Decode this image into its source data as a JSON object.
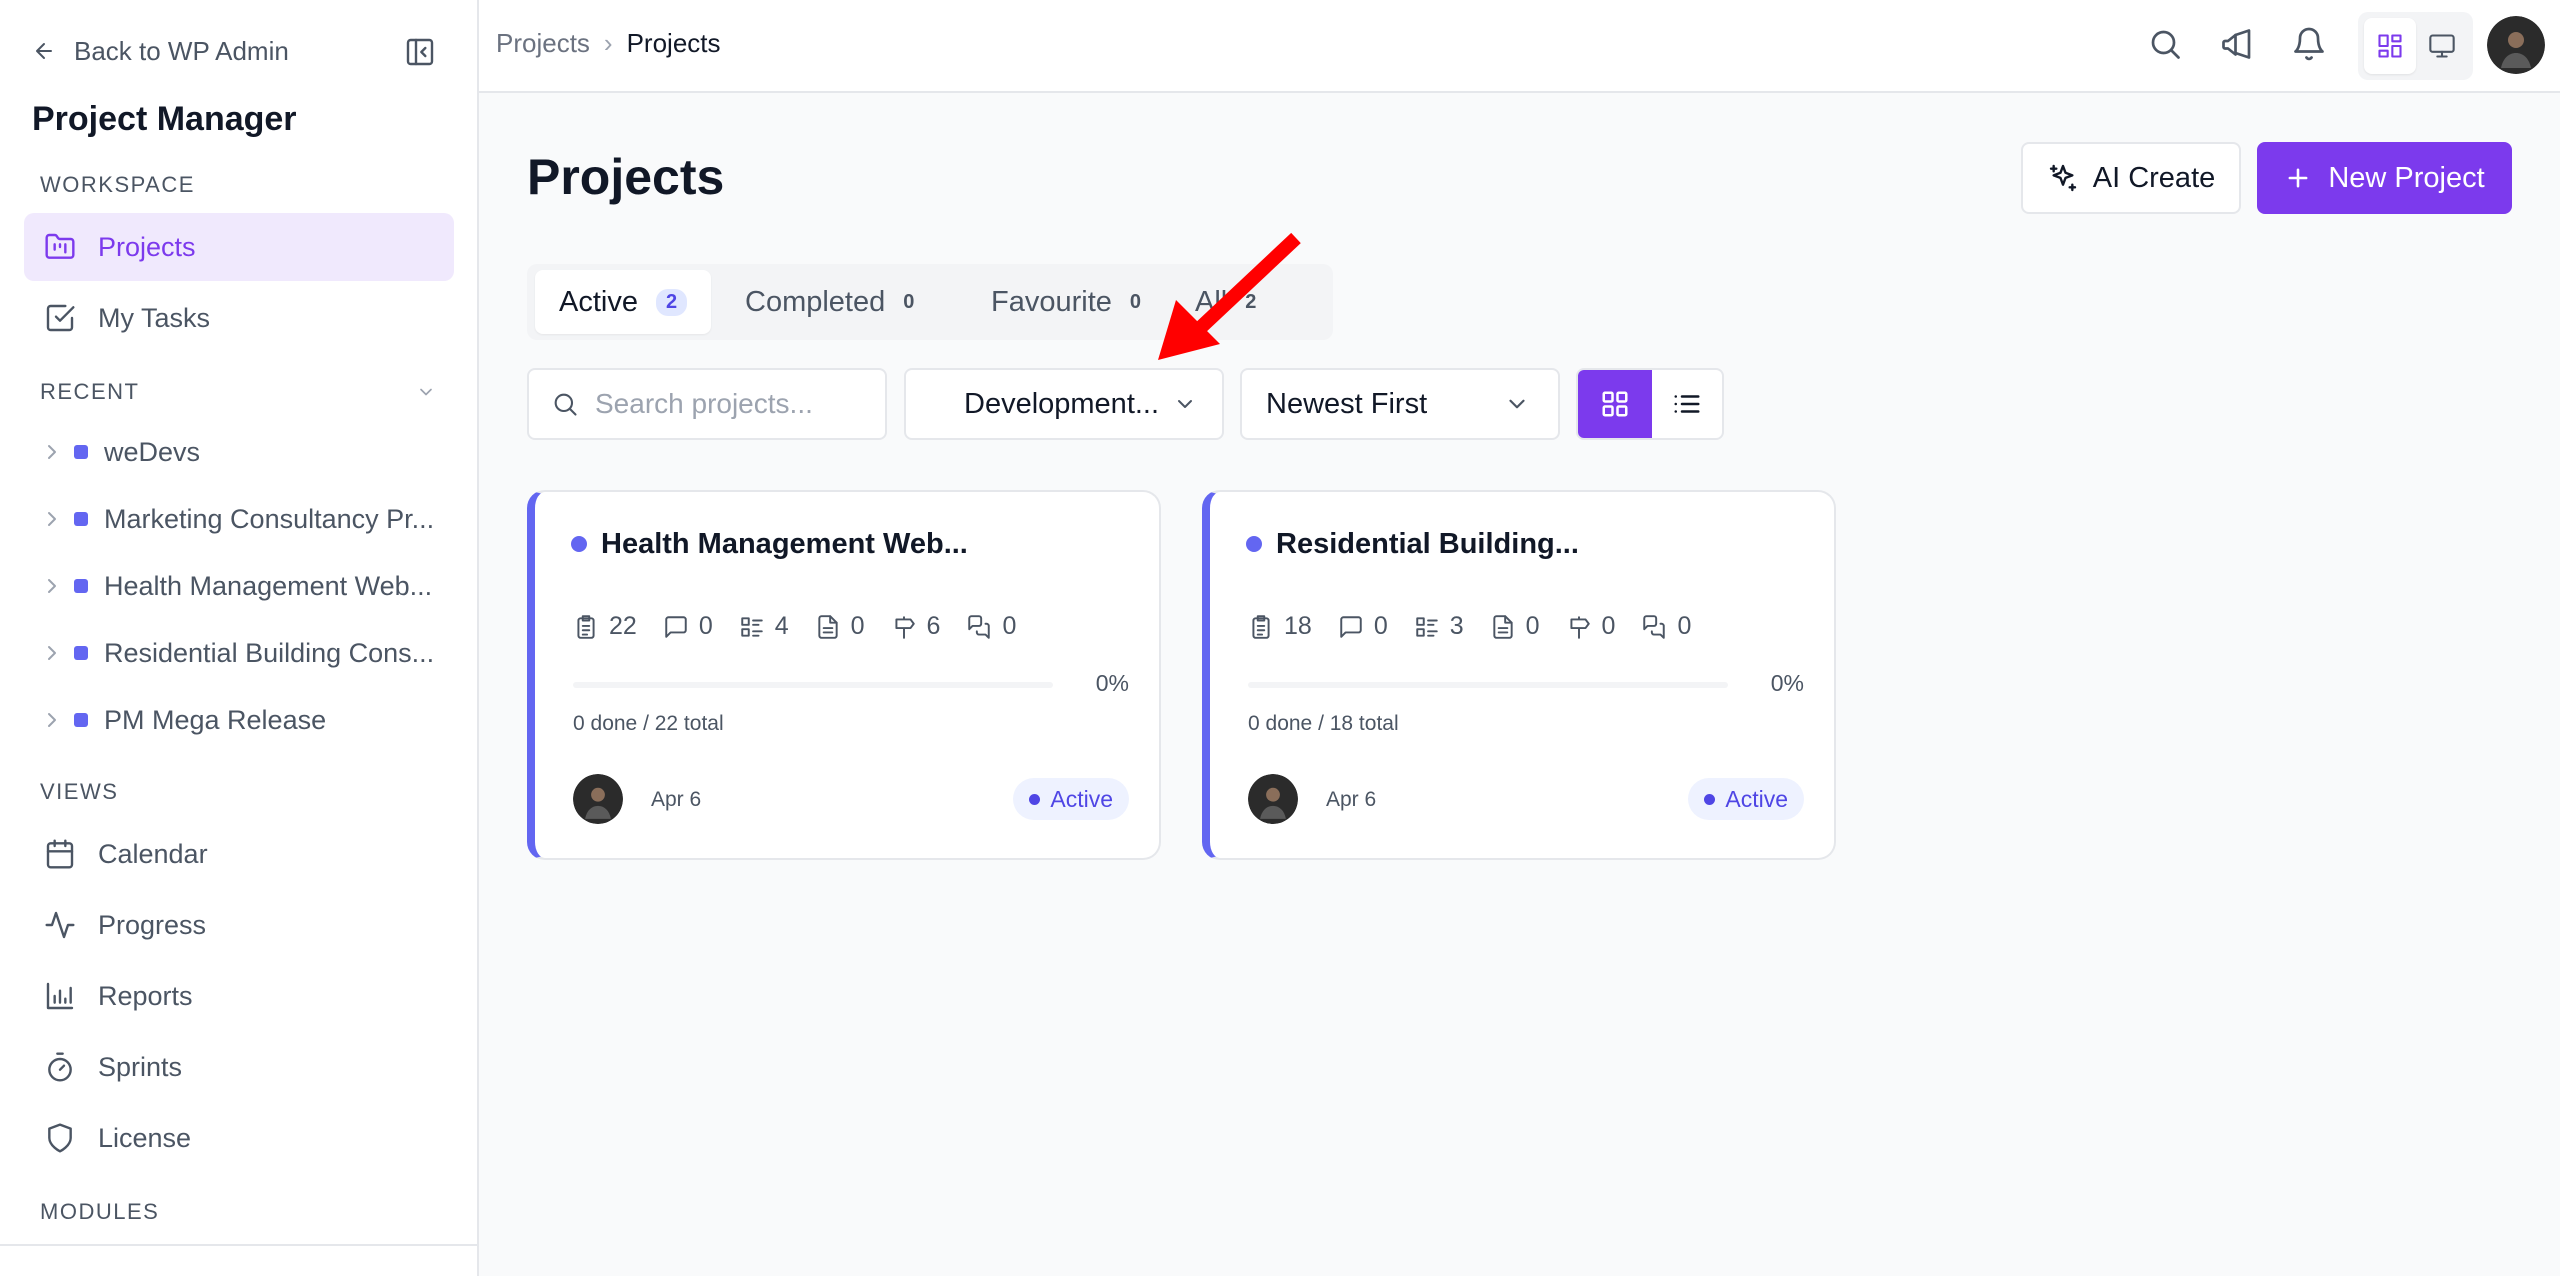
{
  "sidebar": {
    "back_label": "Back to WP Admin",
    "app_title": "Project Manager",
    "workspace_label": "WORKSPACE",
    "workspace_items": [
      {
        "label": "Projects",
        "icon": "folder-kanban-icon",
        "active": true
      },
      {
        "label": "My Tasks",
        "icon": "check-square-icon",
        "active": false
      }
    ],
    "recent_label": "RECENT",
    "recent_items": [
      {
        "label": "weDevs"
      },
      {
        "label": "Marketing Consultancy Pr..."
      },
      {
        "label": "Health Management Web..."
      },
      {
        "label": "Residential Building Cons..."
      },
      {
        "label": "PM Mega Release"
      }
    ],
    "views_label": "VIEWS",
    "views_items": [
      {
        "label": "Calendar",
        "icon": "calendar-icon"
      },
      {
        "label": "Progress",
        "icon": "activity-icon"
      },
      {
        "label": "Reports",
        "icon": "bar-chart-icon"
      },
      {
        "label": "Sprints",
        "icon": "timer-icon"
      },
      {
        "label": "License",
        "icon": "shield-icon"
      }
    ],
    "modules_label": "MODULES"
  },
  "topbar": {
    "breadcrumb_parent": "Projects",
    "breadcrumb_separator": "›",
    "breadcrumb_current": "Projects"
  },
  "main": {
    "title": "Projects",
    "ai_create_label": "AI Create",
    "new_project_label": "New Project",
    "tabs": [
      {
        "label": "Active",
        "count": "2"
      },
      {
        "label": "Completed",
        "count": "0"
      },
      {
        "label": "Favourite",
        "count": "0"
      },
      {
        "label": "All",
        "count": "2"
      }
    ],
    "search_placeholder": "Search projects...",
    "category_value": "Development...",
    "sort_value": "Newest First"
  },
  "projects": [
    {
      "title": "Health Management Web...",
      "tasks": "22",
      "comments": "0",
      "lists": "4",
      "files": "0",
      "milestones": "6",
      "discussions": "0",
      "progress_pct": "0%",
      "progress_value": 0,
      "done_total": "0 done / 22 total",
      "date": "Apr 6",
      "status": "Active"
    },
    {
      "title": "Residential Building...",
      "tasks": "18",
      "comments": "0",
      "lists": "3",
      "files": "0",
      "milestones": "0",
      "discussions": "0",
      "progress_pct": "0%",
      "progress_value": 0,
      "done_total": "0 done / 18 total",
      "date": "Apr 6",
      "status": "Active"
    }
  ],
  "colors": {
    "accent": "#7c3aed",
    "project_indicator": "#6366f1",
    "annotation_arrow": "#ff0000"
  }
}
